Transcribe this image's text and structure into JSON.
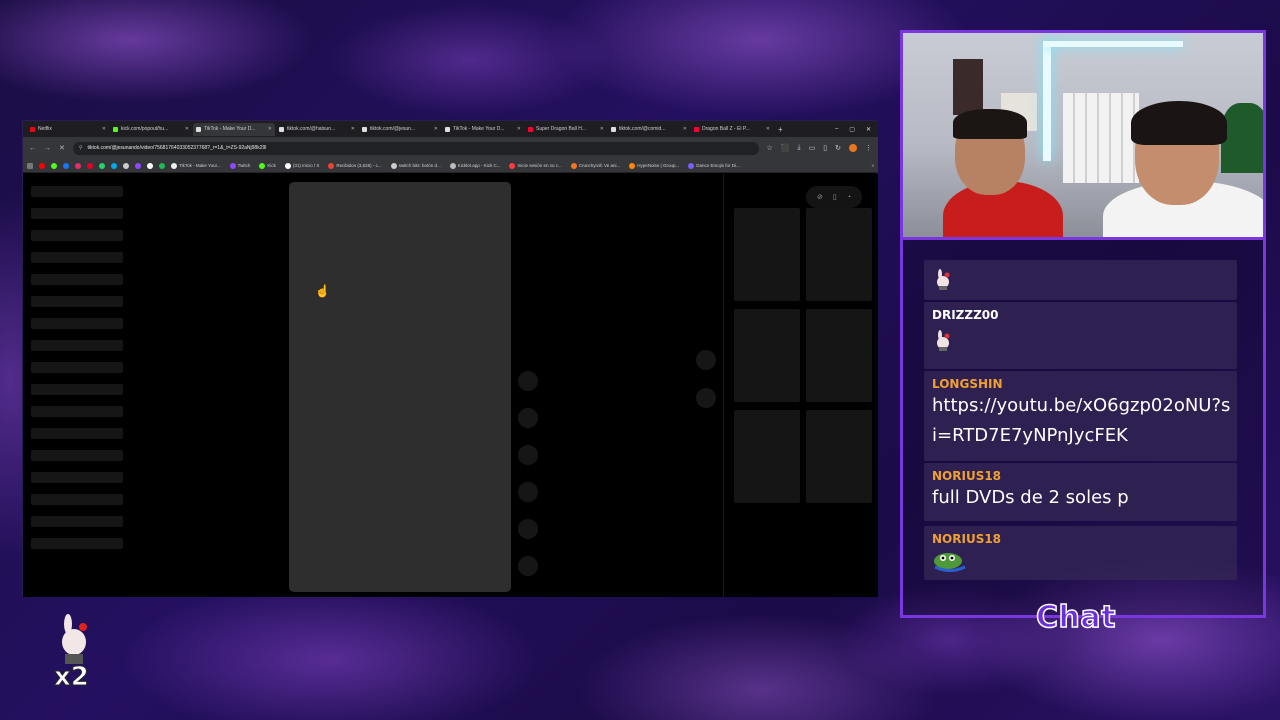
{
  "browser": {
    "tabs": [
      {
        "label": "Netflix",
        "color": "#e50914",
        "active": false
      },
      {
        "label": "kick.com/popout/hu...",
        "color": "#53fc18",
        "active": false
      },
      {
        "label": "TikTok - Make Your D...",
        "color": "#dddddd",
        "active": true
      },
      {
        "label": "tiktok.com/@hatsun...",
        "color": "#dddddd",
        "active": false
      },
      {
        "label": "tiktok.com/@jesun...",
        "color": "#dddddd",
        "active": false
      },
      {
        "label": "TikTok - Make Your D...",
        "color": "#dddddd",
        "active": false
      },
      {
        "label": "Super Dragon Ball H...",
        "color": "#ff0033",
        "active": false
      },
      {
        "label": "tiktok.com/@comid...",
        "color": "#dddddd",
        "active": false
      },
      {
        "label": "Dragon Ball Z - El P...",
        "color": "#ff0033",
        "active": false
      }
    ],
    "new_tab": "+",
    "window_controls": {
      "minimize": "–",
      "maximize": "▢",
      "close": "✕"
    },
    "url": "tiktok.com/@jesunando/video/7568176403305237768?_r=1&_t=ZS-92aNj98k29l",
    "bookmarks": [
      {
        "label": "TikTok - Make Your...",
        "color": "#eeeeee"
      },
      {
        "label": "Twitch",
        "color": "#9146ff"
      },
      {
        "label": "Kick",
        "color": "#53fc18"
      },
      {
        "label": "(31) Inicio / X",
        "color": "#ffffff"
      },
      {
        "label": "Recibidos (3,628) - c...",
        "color": "#ea4335"
      },
      {
        "label": "switch bits: botón d...",
        "color": "#cccccc"
      },
      {
        "label": "Kicklet.app - Kick C...",
        "color": "#bbbbbb"
      },
      {
        "label": "Inicie sesión en su c...",
        "color": "#ff3b3b"
      },
      {
        "label": "Crunchyroll: Ve ani...",
        "color": "#f47521"
      },
      {
        "label": "HypeNoise | Group...",
        "color": "#ff8800"
      },
      {
        "label": "Dance Emojis for Di...",
        "color": "#7b5cff"
      }
    ],
    "bookmark_favicon_colors": [
      "#ff0000",
      "#53fc18",
      "#1877f2",
      "#e1306c",
      "#e60023",
      "#25d366",
      "#00a8e8",
      "#cccccc",
      "#9146ff",
      "#ffffff",
      "#1db954"
    ],
    "page_toolbar_icons": [
      "⊘",
      "▯",
      "◔"
    ],
    "left_skeleton_count": 17,
    "action_dot_count": 6
  },
  "chat": {
    "messages": [
      {
        "user": "",
        "user_color": "#f0a030",
        "text": "",
        "emote": "bunny-sprite"
      },
      {
        "user": "DRIZZZ00",
        "user_color": "#ffffff",
        "text": "",
        "emote": "bunny-sprite"
      },
      {
        "user": "LONGSHIN",
        "user_color": "#f0a030",
        "text": "https://youtu.be/xO6gzp02oNU?si=RTD7E7yNPnJycFEK",
        "emote": ""
      },
      {
        "user": "NORIUS18",
        "user_color": "#f0a030",
        "text": "full DVDs de 2 soles p",
        "emote": ""
      },
      {
        "user": "NORIUS18",
        "user_color": "#f0a030",
        "text": "",
        "emote": "pepe-frog"
      }
    ],
    "title": "Chat"
  },
  "overlay": {
    "multiplier": "x2"
  },
  "colors": {
    "frame_purple": "#7a37e0",
    "username_orange": "#f0a030",
    "background": "#1a0d44"
  }
}
